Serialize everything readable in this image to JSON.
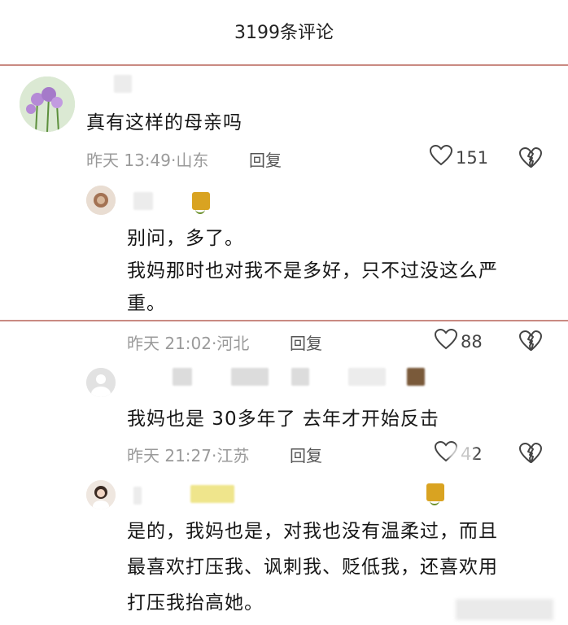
{
  "header": {
    "title": "3199条评论"
  },
  "comments": [
    {
      "text": "真有这样的母亲吗",
      "time": "昨天 13:49",
      "location": "山东",
      "reply_label": "回复",
      "likes": "151"
    },
    {
      "text_lines": [
        "别问，多了。",
        "我妈那时也对我不是多好，只不过没这么严",
        "重。"
      ],
      "time": "昨天 21:02",
      "location": "河北",
      "reply_label": "回复",
      "likes": "88"
    },
    {
      "text": "我妈也是  30多年了 去年才开始反击",
      "time": "昨天 21:27",
      "location": "江苏",
      "reply_label": "回复",
      "likes": "42"
    },
    {
      "text_lines": [
        "是的，我妈也是，对我也没有温柔过，而且",
        "最喜欢打压我、讽刺我、贬低我，还喜欢用",
        "打压我抬高她。"
      ]
    }
  ],
  "colors": {
    "divider": "#c98a82",
    "meta": "#9a9a9a",
    "badge": "#d9a321"
  },
  "icons": {
    "like": "heart-outline-icon",
    "dislike": "broken-heart-icon"
  }
}
